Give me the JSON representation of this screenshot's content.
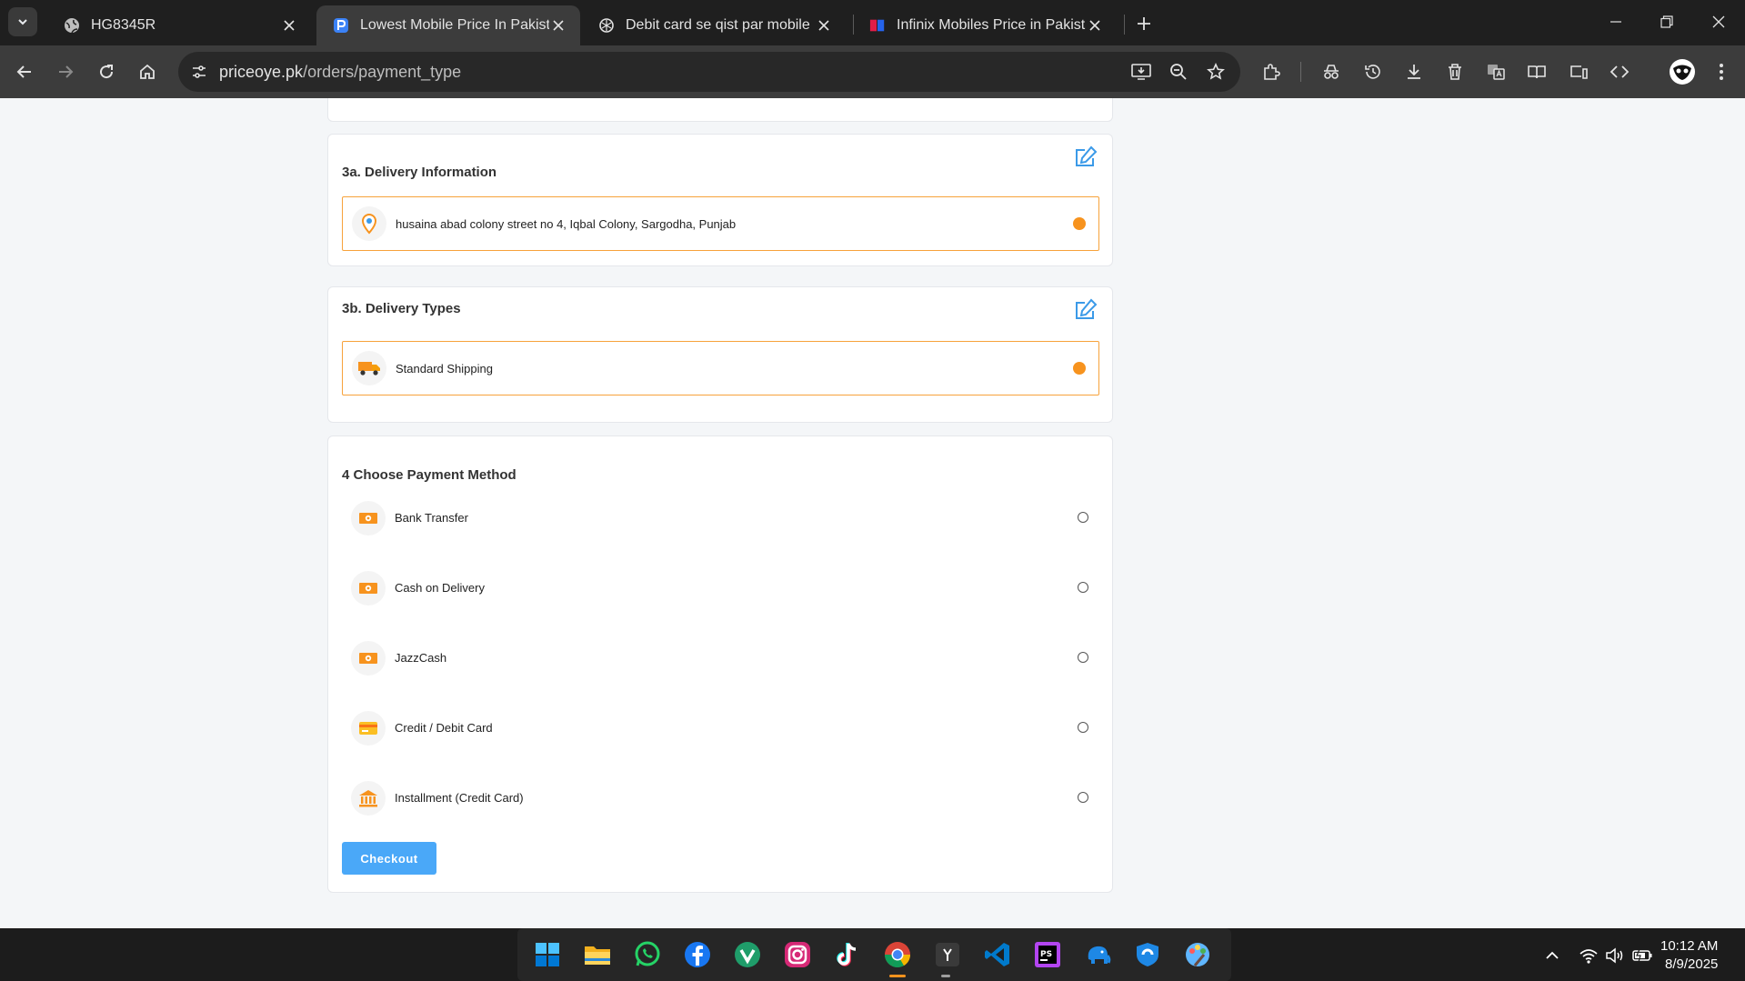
{
  "browser": {
    "tabs": [
      {
        "title": "HG8345R",
        "active": false
      },
      {
        "title": "Lowest Mobile Price In Pakistan",
        "active": true
      },
      {
        "title": "Debit card se qist par mobile",
        "active": false
      },
      {
        "title": "Infinix Mobiles Price in Pakistan",
        "active": false
      }
    ],
    "url_host": "priceoye.pk",
    "url_path": "/orders/payment_type"
  },
  "delivery_info": {
    "title": "3a. Delivery Information",
    "address": "husaina abad colony street no 4, Iqbal Colony, Sargodha, Punjab"
  },
  "delivery_types": {
    "title": "3b. Delivery Types",
    "option": "Standard Shipping"
  },
  "payment": {
    "title": "4 Choose Payment Method",
    "methods": [
      {
        "label": "Bank Transfer",
        "icon": "cash-icon"
      },
      {
        "label": "Cash on Delivery",
        "icon": "cash-icon"
      },
      {
        "label": "JazzCash",
        "icon": "cash-icon"
      },
      {
        "label": "Credit / Debit Card",
        "icon": "card-icon"
      },
      {
        "label": "Installment (Credit Card)",
        "icon": "bank-icon"
      }
    ],
    "checkout_label": "Checkout"
  },
  "colors": {
    "accent": "#f7931e",
    "primary_button": "#4aa8f8",
    "edit_icon": "#3b9ae8"
  },
  "taskbar": {
    "time": "10:12 AM",
    "date": "8/9/2025"
  }
}
